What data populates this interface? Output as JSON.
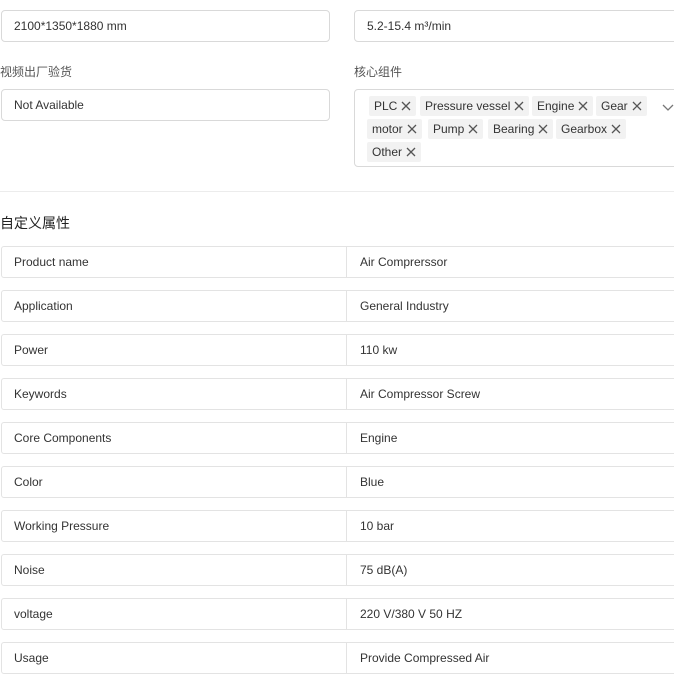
{
  "fields": {
    "size_value": "2100*1350*1880 mm",
    "flow_value": "5.2-15.4  m³/min",
    "video_label": "视频出厂验货",
    "video_value": "Not Available",
    "components_label": "核心组件"
  },
  "core_components": [
    "PLC",
    "Pressure vessel",
    "Engine",
    "Gear",
    "motor",
    "Pump",
    "Bearing",
    "Gearbox",
    "Other"
  ],
  "custom_attributes": {
    "title": "自定义属性",
    "rows": [
      {
        "key": "Product name",
        "value": "Air Comprerssor"
      },
      {
        "key": "Application",
        "value": "General Industry"
      },
      {
        "key": "Power",
        "value": "110 kw"
      },
      {
        "key": "Keywords",
        "value": "Air Compressor Screw"
      },
      {
        "key": "Core Components",
        "value": "Engine"
      },
      {
        "key": "Color",
        "value": "Blue"
      },
      {
        "key": "Working Pressure",
        "value": "10 bar"
      },
      {
        "key": "Noise",
        "value": "75 dB(A)"
      },
      {
        "key": "voltage",
        "value": "220 V/380 V 50 HZ"
      },
      {
        "key": "Usage",
        "value": "Provide Compressed Air"
      }
    ]
  }
}
